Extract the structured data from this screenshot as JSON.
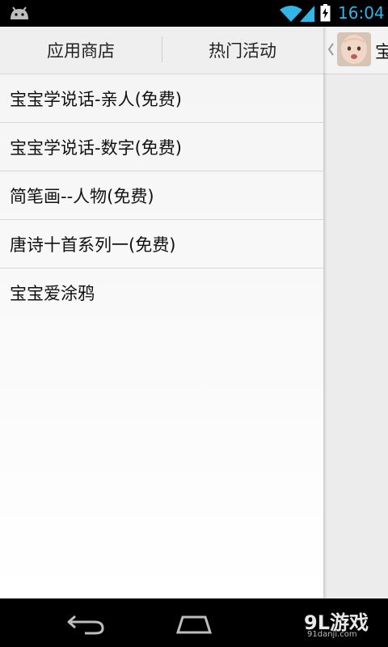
{
  "status_bar": {
    "time": "16:04",
    "clock_color": "#33b5e5",
    "icons": [
      "android-icon",
      "wifi-icon",
      "signal-icon",
      "battery-charging-icon"
    ]
  },
  "drawer": {
    "tabs": [
      {
        "label": "应用商店"
      },
      {
        "label": "热门活动"
      }
    ],
    "items": [
      {
        "label": "宝宝学说话-亲人(免费)"
      },
      {
        "label": "宝宝学说话-数字(免费)"
      },
      {
        "label": "简笔画--人物(免费)"
      },
      {
        "label": "唐诗十首系列一(免费)"
      },
      {
        "label": "宝宝爱涂鸦"
      }
    ]
  },
  "peek_panel": {
    "title": "宝",
    "icons": [
      "back-chevron-icon",
      "baby-avatar"
    ]
  },
  "nav_bar": {
    "icons": [
      "back-icon",
      "home-icon"
    ]
  },
  "watermark": {
    "logo": "9L游戏",
    "url": "91danji.com"
  }
}
